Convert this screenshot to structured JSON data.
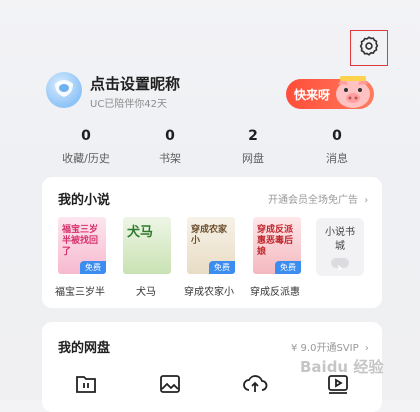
{
  "profile": {
    "nickname": "点击设置昵称",
    "subline": "UC已陪伴你42天"
  },
  "promo": {
    "label": "快来呀"
  },
  "stats": [
    {
      "num": "0",
      "label": "收藏/历史"
    },
    {
      "num": "0",
      "label": "书架"
    },
    {
      "num": "2",
      "label": "网盘"
    },
    {
      "num": "0",
      "label": "消息"
    }
  ],
  "novels": {
    "title": "我的小说",
    "link": "开通会员全场免广告",
    "free_tag": "免费",
    "books": [
      {
        "name": "福宝三岁半",
        "cover_text": "福宝三岁半被找回了"
      },
      {
        "name": "犬马",
        "cover_text": "犬马"
      },
      {
        "name": "穿成农家小",
        "cover_text": "穿成农家小"
      },
      {
        "name": "穿成反派惠",
        "cover_text": "穿成反派惠恶毒后娘"
      }
    ],
    "mall": "小说书城"
  },
  "netdisk": {
    "title": "我的网盘",
    "link": "¥ 9.0开通SVIP",
    "icons": [
      "folder-icon",
      "image-icon",
      "upload-cloud-icon",
      "video-icon"
    ]
  },
  "watermark": "Baidu 经验",
  "colors": {
    "accent": "#3c8df0",
    "promo": "#ff4d3a",
    "settings_highlight": "#e03b3b"
  }
}
